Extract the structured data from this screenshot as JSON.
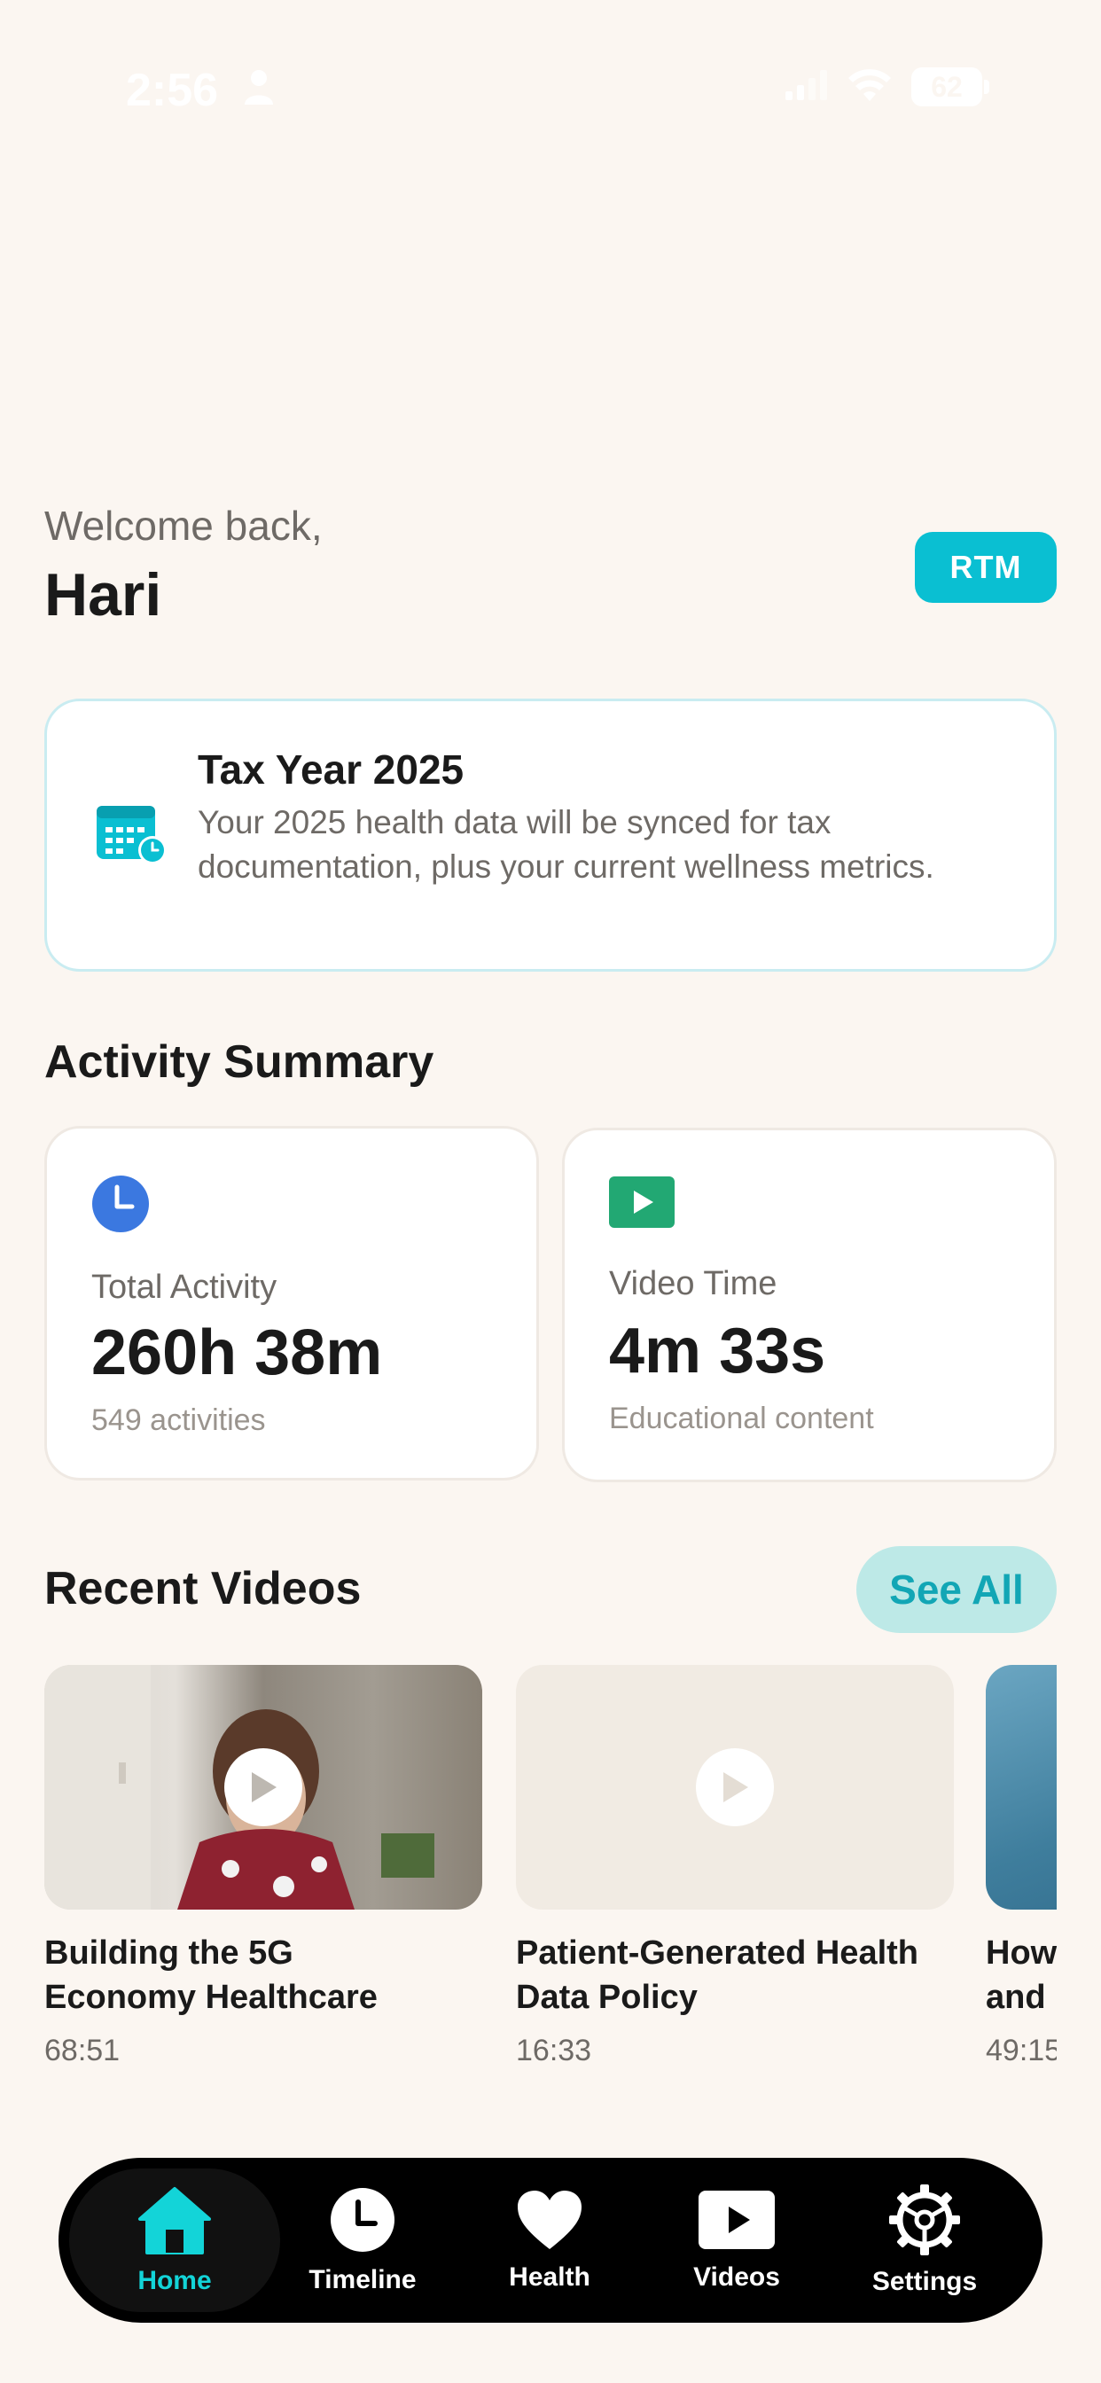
{
  "status_bar": {
    "time": "2:56",
    "battery": "62"
  },
  "header": {
    "welcome": "Welcome back,",
    "user_name": "Hari",
    "rtm_label": "RTM"
  },
  "tax_card": {
    "title": "Tax Year 2025",
    "description": "Your 2025 health data will be synced for tax documentation, plus your current wellness metrics."
  },
  "activity_summary": {
    "title": "Activity Summary",
    "cards": [
      {
        "label": "Total Activity",
        "value": "260h 38m",
        "sub": "549 activities",
        "icon": "clock-icon"
      },
      {
        "label": "Video Time",
        "value": "4m 33s",
        "sub": "Educational content",
        "icon": "play-icon"
      }
    ]
  },
  "recent_videos": {
    "title": "Recent Videos",
    "see_all_label": "See All",
    "videos": [
      {
        "title_line1": "Building the 5G",
        "title_line2": "Economy Healthcare",
        "duration": "68:51"
      },
      {
        "title_line1": "Patient-Generated Health",
        "title_line2": "Data Policy",
        "duration": "16:33"
      },
      {
        "title_line1": "How",
        "title_line2": "and",
        "duration": "49:15"
      }
    ]
  },
  "tab_bar": {
    "tabs": [
      {
        "label": "Home",
        "icon": "home-icon",
        "active": true
      },
      {
        "label": "Timeline",
        "icon": "clock-icon",
        "active": false
      },
      {
        "label": "Health",
        "icon": "heart-icon",
        "active": false
      },
      {
        "label": "Videos",
        "icon": "play-icon",
        "active": false
      },
      {
        "label": "Settings",
        "icon": "gear-icon",
        "active": false
      }
    ]
  },
  "colors": {
    "background": "#FBF6F1",
    "accent": "#0ABFD2",
    "active_tab": "#13D4D8",
    "activity_icon": "#3B78E0",
    "video_icon": "#22A873"
  }
}
